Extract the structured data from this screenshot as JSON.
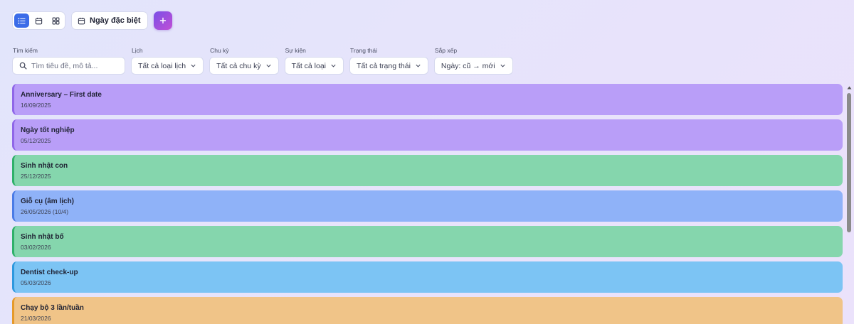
{
  "toolbar": {
    "views": [
      {
        "icon": "list-icon",
        "active": true
      },
      {
        "icon": "calendar-icon",
        "active": false
      },
      {
        "icon": "grid-icon",
        "active": false
      }
    ],
    "special_label": "Ngày đặc biệt",
    "add_icon": "plus-icon"
  },
  "filters": {
    "search": {
      "label": "Tìm kiếm",
      "placeholder": "Tìm tiêu đề, mô tả..."
    },
    "calendar": {
      "label": "Lịch",
      "value": "Tất cả loại lịch"
    },
    "cycle": {
      "label": "Chu kỳ",
      "value": "Tất cả chu kỳ"
    },
    "event": {
      "label": "Sự kiện",
      "value": "Tất cả loại"
    },
    "status": {
      "label": "Trạng thái",
      "value": "Tất cả trạng thái"
    },
    "sort": {
      "label": "Sắp xếp",
      "value": "Ngày: cũ → mới"
    }
  },
  "events": [
    {
      "title": "Anniversary – First date",
      "date": "16/09/2025",
      "bg": "#b99ef8",
      "border": "#8f66e8"
    },
    {
      "title": "Ngày tốt nghiệp",
      "date": "05/12/2025",
      "bg": "#b99ef8",
      "border": "#8f66e8"
    },
    {
      "title": "Sinh nhật con",
      "date": "25/12/2025",
      "bg": "#85d6ad",
      "border": "#2fb06a"
    },
    {
      "title": "Giỗ cụ (âm lịch)",
      "date": "26/05/2026 (10/4)",
      "bg": "#8fb2f8",
      "border": "#4a7be6"
    },
    {
      "title": "Sinh nhật bố",
      "date": "03/02/2026",
      "bg": "#85d6ad",
      "border": "#2fb06a"
    },
    {
      "title": "Dentist check-up",
      "date": "05/03/2026",
      "bg": "#7cc4f4",
      "border": "#2d98de"
    },
    {
      "title": "Chạy bộ 3 lần/tuần",
      "date": "21/03/2026",
      "bg": "#f0c488",
      "border": "#e59a2a"
    }
  ],
  "colors": {
    "accent": "#3b6ce8",
    "add_gradient_start": "#7a4fe6",
    "add_gradient_end": "#c14fd6"
  }
}
